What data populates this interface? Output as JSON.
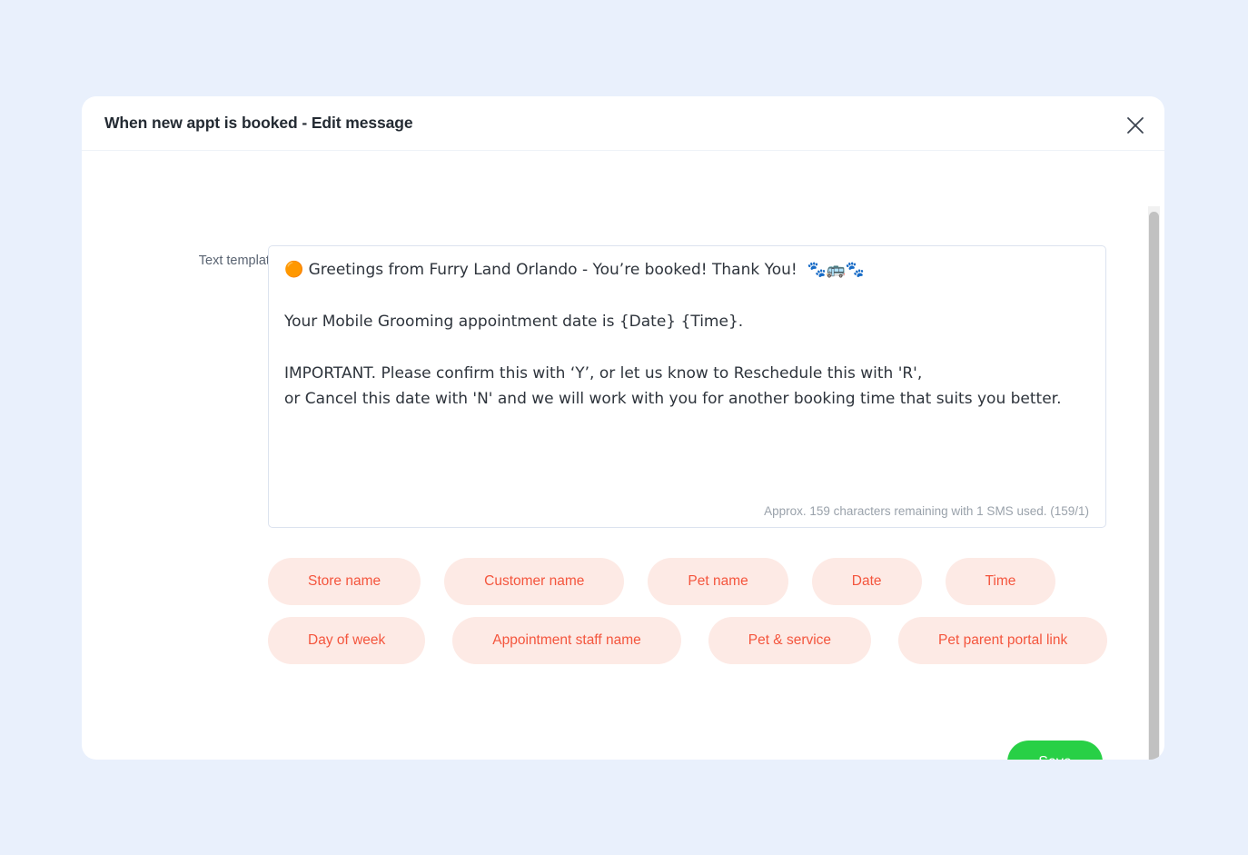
{
  "page": {
    "background_color": "#e9f0fc"
  },
  "modal": {
    "title": "When new appt is booked - Edit message",
    "close_icon": "close-x-icon"
  },
  "form": {
    "label": "Text template",
    "template_value": "🟠 Greetings from Furry Land Orlando - You’re booked! Thank You!  🐾🚌🐾\n\nYour Mobile Grooming appointment date is {Date} {Time}.\n\nIMPORTANT. Please confirm this with ‘Y’, or let us know to Reschedule this with 'R',\nor Cancel this date with 'N' and we will work with you for another booking time that suits you better.",
    "char_counter": "Approx. 159 characters remaining with 1 SMS used. (159/1)"
  },
  "tokens": {
    "row1": [
      {
        "label": "Store name"
      },
      {
        "label": "Customer name"
      },
      {
        "label": "Pet name"
      },
      {
        "label": "Date"
      },
      {
        "label": "Time"
      }
    ],
    "row2": [
      {
        "label": "Day of week"
      },
      {
        "label": "Appointment staff name"
      },
      {
        "label": "Pet & service"
      },
      {
        "label": "Pet parent portal link"
      }
    ]
  },
  "actions": {
    "save_label": "Save"
  },
  "colors": {
    "accent_green": "#28d046",
    "chip_background": "#fdeae5",
    "chip_text": "#f4553d",
    "page_background": "#e9f0fc",
    "title_text": "#242b33"
  }
}
